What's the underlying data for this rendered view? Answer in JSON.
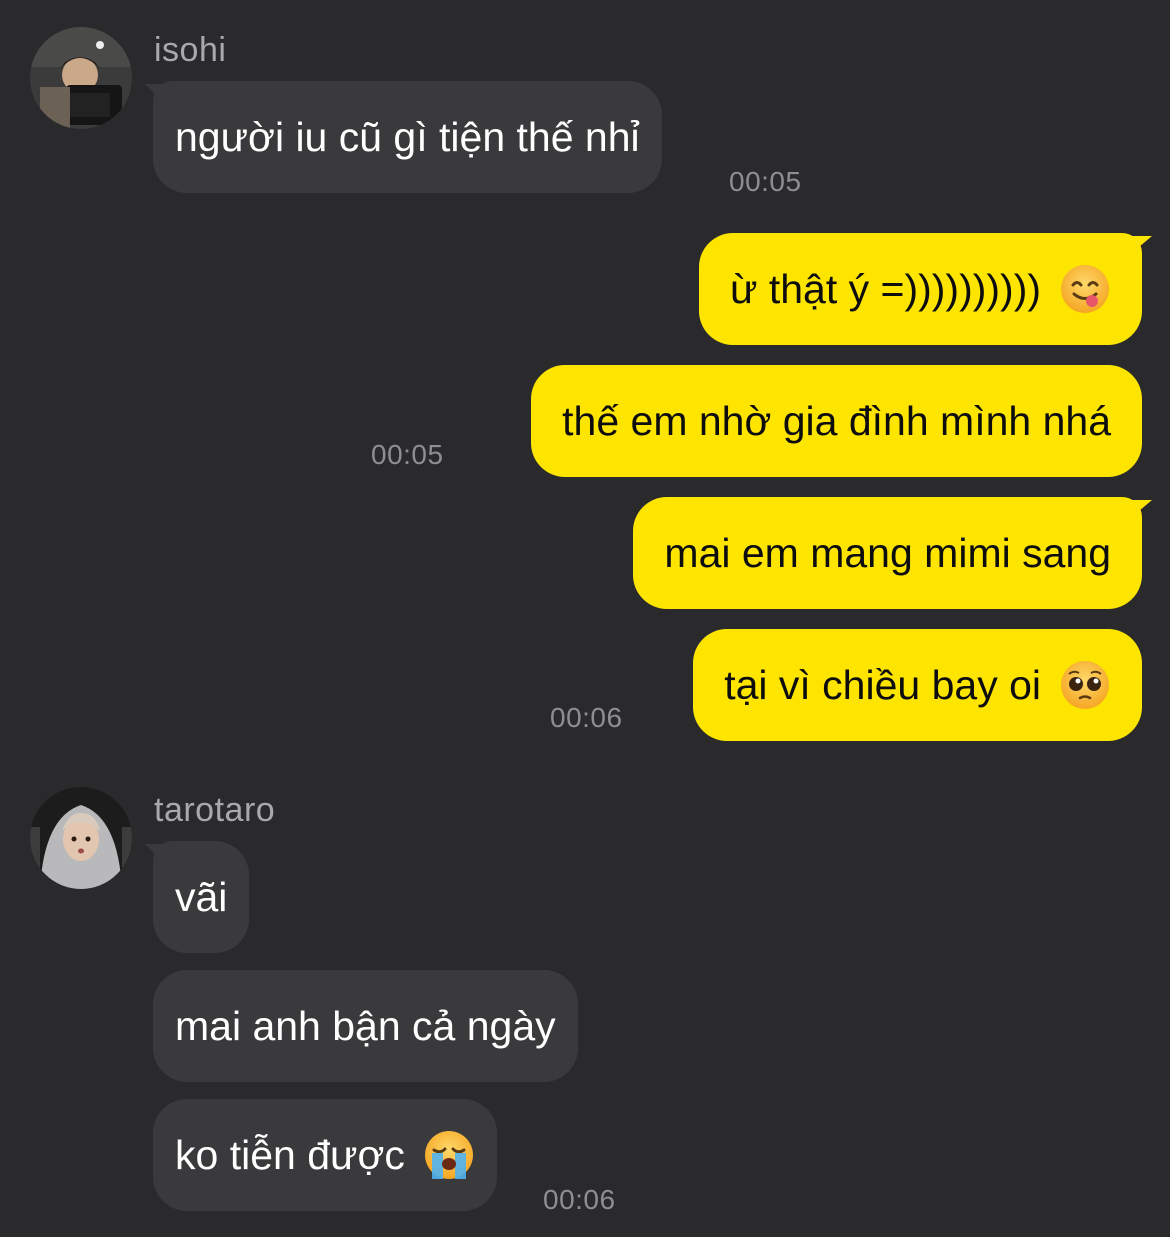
{
  "groups": [
    {
      "username": "isohi",
      "messages": [
        {
          "text": "người iu cũ gì tiện thế nhỉ"
        }
      ],
      "time": "00:05"
    },
    {
      "messages": [
        {
          "text": "ừ thật ý =))))))))))",
          "emoji": "face-savoring-food-emoji"
        },
        {
          "text": "thế em nhờ gia đình mình nhá"
        }
      ],
      "time": "00:05"
    },
    {
      "messages": [
        {
          "text": "mai em mang mimi sang"
        },
        {
          "text": "tại vì chiều bay oi",
          "emoji": "pleading-face-emoji"
        }
      ],
      "time": "00:06"
    },
    {
      "username": "tarotaro",
      "messages": [
        {
          "text": "vãi"
        },
        {
          "text": "mai anh bận cả ngày"
        },
        {
          "text": "ko tiễn được",
          "emoji": "loudly-crying-face-emoji"
        }
      ],
      "time": "00:06"
    }
  ],
  "colors": {
    "background": "#2a2a2c",
    "incoming_bubble": "#3a3a3c",
    "outgoing_bubble": "#fee500",
    "timestamp": "#8e8e92",
    "username": "#a9a9ad"
  }
}
